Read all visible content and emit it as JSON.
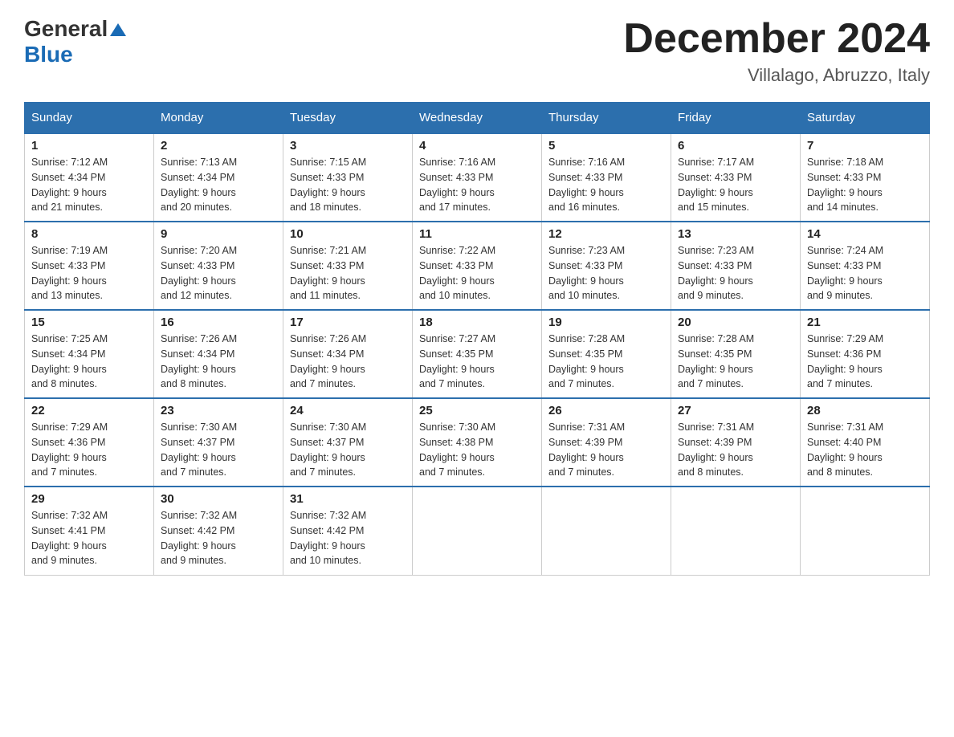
{
  "header": {
    "logo": {
      "general": "General",
      "blue": "Blue",
      "alt": "GeneralBlue logo"
    },
    "title": "December 2024",
    "location": "Villalago, Abruzzo, Italy"
  },
  "days_of_week": [
    "Sunday",
    "Monday",
    "Tuesday",
    "Wednesday",
    "Thursday",
    "Friday",
    "Saturday"
  ],
  "weeks": [
    [
      {
        "day": "1",
        "sunrise": "7:12 AM",
        "sunset": "4:34 PM",
        "daylight": "9 hours and 21 minutes."
      },
      {
        "day": "2",
        "sunrise": "7:13 AM",
        "sunset": "4:34 PM",
        "daylight": "9 hours and 20 minutes."
      },
      {
        "day": "3",
        "sunrise": "7:15 AM",
        "sunset": "4:33 PM",
        "daylight": "9 hours and 18 minutes."
      },
      {
        "day": "4",
        "sunrise": "7:16 AM",
        "sunset": "4:33 PM",
        "daylight": "9 hours and 17 minutes."
      },
      {
        "day": "5",
        "sunrise": "7:16 AM",
        "sunset": "4:33 PM",
        "daylight": "9 hours and 16 minutes."
      },
      {
        "day": "6",
        "sunrise": "7:17 AM",
        "sunset": "4:33 PM",
        "daylight": "9 hours and 15 minutes."
      },
      {
        "day": "7",
        "sunrise": "7:18 AM",
        "sunset": "4:33 PM",
        "daylight": "9 hours and 14 minutes."
      }
    ],
    [
      {
        "day": "8",
        "sunrise": "7:19 AM",
        "sunset": "4:33 PM",
        "daylight": "9 hours and 13 minutes."
      },
      {
        "day": "9",
        "sunrise": "7:20 AM",
        "sunset": "4:33 PM",
        "daylight": "9 hours and 12 minutes."
      },
      {
        "day": "10",
        "sunrise": "7:21 AM",
        "sunset": "4:33 PM",
        "daylight": "9 hours and 11 minutes."
      },
      {
        "day": "11",
        "sunrise": "7:22 AM",
        "sunset": "4:33 PM",
        "daylight": "9 hours and 10 minutes."
      },
      {
        "day": "12",
        "sunrise": "7:23 AM",
        "sunset": "4:33 PM",
        "daylight": "9 hours and 10 minutes."
      },
      {
        "day": "13",
        "sunrise": "7:23 AM",
        "sunset": "4:33 PM",
        "daylight": "9 hours and 9 minutes."
      },
      {
        "day": "14",
        "sunrise": "7:24 AM",
        "sunset": "4:33 PM",
        "daylight": "9 hours and 9 minutes."
      }
    ],
    [
      {
        "day": "15",
        "sunrise": "7:25 AM",
        "sunset": "4:34 PM",
        "daylight": "9 hours and 8 minutes."
      },
      {
        "day": "16",
        "sunrise": "7:26 AM",
        "sunset": "4:34 PM",
        "daylight": "9 hours and 8 minutes."
      },
      {
        "day": "17",
        "sunrise": "7:26 AM",
        "sunset": "4:34 PM",
        "daylight": "9 hours and 7 minutes."
      },
      {
        "day": "18",
        "sunrise": "7:27 AM",
        "sunset": "4:35 PM",
        "daylight": "9 hours and 7 minutes."
      },
      {
        "day": "19",
        "sunrise": "7:28 AM",
        "sunset": "4:35 PM",
        "daylight": "9 hours and 7 minutes."
      },
      {
        "day": "20",
        "sunrise": "7:28 AM",
        "sunset": "4:35 PM",
        "daylight": "9 hours and 7 minutes."
      },
      {
        "day": "21",
        "sunrise": "7:29 AM",
        "sunset": "4:36 PM",
        "daylight": "9 hours and 7 minutes."
      }
    ],
    [
      {
        "day": "22",
        "sunrise": "7:29 AM",
        "sunset": "4:36 PM",
        "daylight": "9 hours and 7 minutes."
      },
      {
        "day": "23",
        "sunrise": "7:30 AM",
        "sunset": "4:37 PM",
        "daylight": "9 hours and 7 minutes."
      },
      {
        "day": "24",
        "sunrise": "7:30 AM",
        "sunset": "4:37 PM",
        "daylight": "9 hours and 7 minutes."
      },
      {
        "day": "25",
        "sunrise": "7:30 AM",
        "sunset": "4:38 PM",
        "daylight": "9 hours and 7 minutes."
      },
      {
        "day": "26",
        "sunrise": "7:31 AM",
        "sunset": "4:39 PM",
        "daylight": "9 hours and 7 minutes."
      },
      {
        "day": "27",
        "sunrise": "7:31 AM",
        "sunset": "4:39 PM",
        "daylight": "9 hours and 8 minutes."
      },
      {
        "day": "28",
        "sunrise": "7:31 AM",
        "sunset": "4:40 PM",
        "daylight": "9 hours and 8 minutes."
      }
    ],
    [
      {
        "day": "29",
        "sunrise": "7:32 AM",
        "sunset": "4:41 PM",
        "daylight": "9 hours and 9 minutes."
      },
      {
        "day": "30",
        "sunrise": "7:32 AM",
        "sunset": "4:42 PM",
        "daylight": "9 hours and 9 minutes."
      },
      {
        "day": "31",
        "sunrise": "7:32 AM",
        "sunset": "4:42 PM",
        "daylight": "9 hours and 10 minutes."
      },
      null,
      null,
      null,
      null
    ]
  ],
  "labels": {
    "sunrise": "Sunrise:",
    "sunset": "Sunset:",
    "daylight": "Daylight:"
  }
}
